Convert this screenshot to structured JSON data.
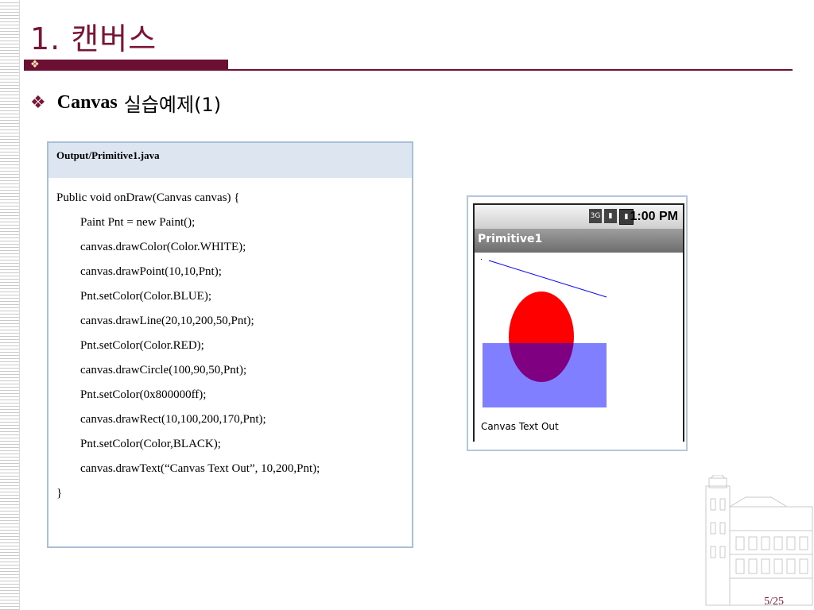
{
  "slide": {
    "title": "1. 캔버스",
    "subtitle_bold": "Canvas",
    "subtitle_rest": "실습예제(1)",
    "page_number": "5/25"
  },
  "code": {
    "header": "Output/Primitive1.java",
    "lines": [
      {
        "text": "Public void onDraw(Canvas canvas) {",
        "indent": false
      },
      {
        "text": "Paint Pnt = new Paint();",
        "indent": true
      },
      {
        "text": "canvas.drawColor(Color.WHITE);",
        "indent": true
      },
      {
        "text": "canvas.drawPoint(10,10,Pnt);",
        "indent": true
      },
      {
        "text": "Pnt.setColor(Color.BLUE);",
        "indent": true
      },
      {
        "text": "canvas.drawLine(20,10,200,50,Pnt);",
        "indent": true
      },
      {
        "text": "Pnt.setColor(Color.RED);",
        "indent": true
      },
      {
        "text": "canvas.drawCircle(100,90,50,Pnt);",
        "indent": true
      },
      {
        "text": "Pnt.setColor(0x800000ff);",
        "indent": true
      },
      {
        "text": "canvas.drawRect(10,100,200,170,Pnt);",
        "indent": true
      },
      {
        "text": "Pnt.setColor(Color,BLACK);",
        "indent": true
      },
      {
        "text": "canvas.drawText(“Canvas Text Out”, 10,200,Pnt);",
        "indent": true
      },
      {
        "text": "}",
        "indent": false
      }
    ]
  },
  "phone": {
    "status_time": "1:00 PM",
    "app_title": "Primitive1",
    "canvas_text": "Canvas Text Out"
  },
  "colors": {
    "accent": "#6b0f33",
    "title": "#7a1538",
    "line_blue": "#0000ff",
    "circle_red": "#ff0000",
    "rect_overlay": "#8080ff"
  }
}
